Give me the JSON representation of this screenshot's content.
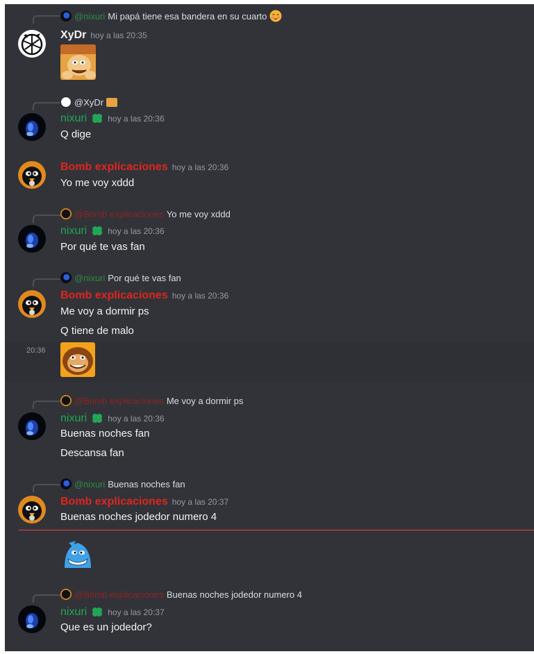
{
  "messages": {
    "m1": {
      "reply_mention": "@nixuri",
      "reply_text": "Mi papá tiene esa bandera en su cuarto",
      "author": "XyDr",
      "timestamp": "hoy a las 20:35"
    },
    "m2": {
      "reply_mention": "@XyDr",
      "author": "nixuri",
      "timestamp": "hoy a las 20:36",
      "lines": [
        "Q dige"
      ]
    },
    "m3": {
      "author": "Bomb explicaciones",
      "timestamp": "hoy a las 20:36",
      "lines": [
        "Yo me voy xddd"
      ]
    },
    "m4": {
      "reply_mention": "@Bomb explicaciones",
      "reply_text": "Yo me voy xddd",
      "author": "nixuri",
      "timestamp": "hoy a las 20:36",
      "lines": [
        "Por qué te vas fan"
      ]
    },
    "m5": {
      "reply_mention": "@nixuri",
      "reply_text": "Por qué te vas fan",
      "author": "Bomb explicaciones",
      "timestamp": "hoy a las 20:36",
      "lines": [
        "Me voy a dormir ps",
        "Q tiene de malo"
      ],
      "sticker_time": "20:36"
    },
    "m6": {
      "reply_mention": "@Bomb explicaciones",
      "reply_text": "Me voy a dormir ps",
      "author": "nixuri",
      "timestamp": "hoy a las 20:36",
      "lines": [
        "Buenas noches fan",
        "Descansa fan"
      ]
    },
    "m7": {
      "reply_mention": "@nixuri",
      "reply_text": "Buenas noches fan",
      "author": "Bomb explicaciones",
      "timestamp": "hoy a las 20:37",
      "lines": [
        "Buenas noches jodedor numero 4"
      ]
    },
    "m8": {
      "reply_mention": "@Bomb explicaciones",
      "reply_text": "Buenas noches jodedor numero 4",
      "author": "nixuri",
      "timestamp": "hoy a las 20:37",
      "lines": [
        "Que es un jodedor?"
      ]
    }
  },
  "colors": {
    "background": "#313338",
    "xydr_name": "#f2f3f5",
    "nixuri_name": "#23a559",
    "bomb_name": "#e0251f",
    "new_messages_divider": "#f23f43"
  },
  "icons": {
    "badge": "four-leaf-clover-icon",
    "emoji": "blushing-face-emoji"
  }
}
